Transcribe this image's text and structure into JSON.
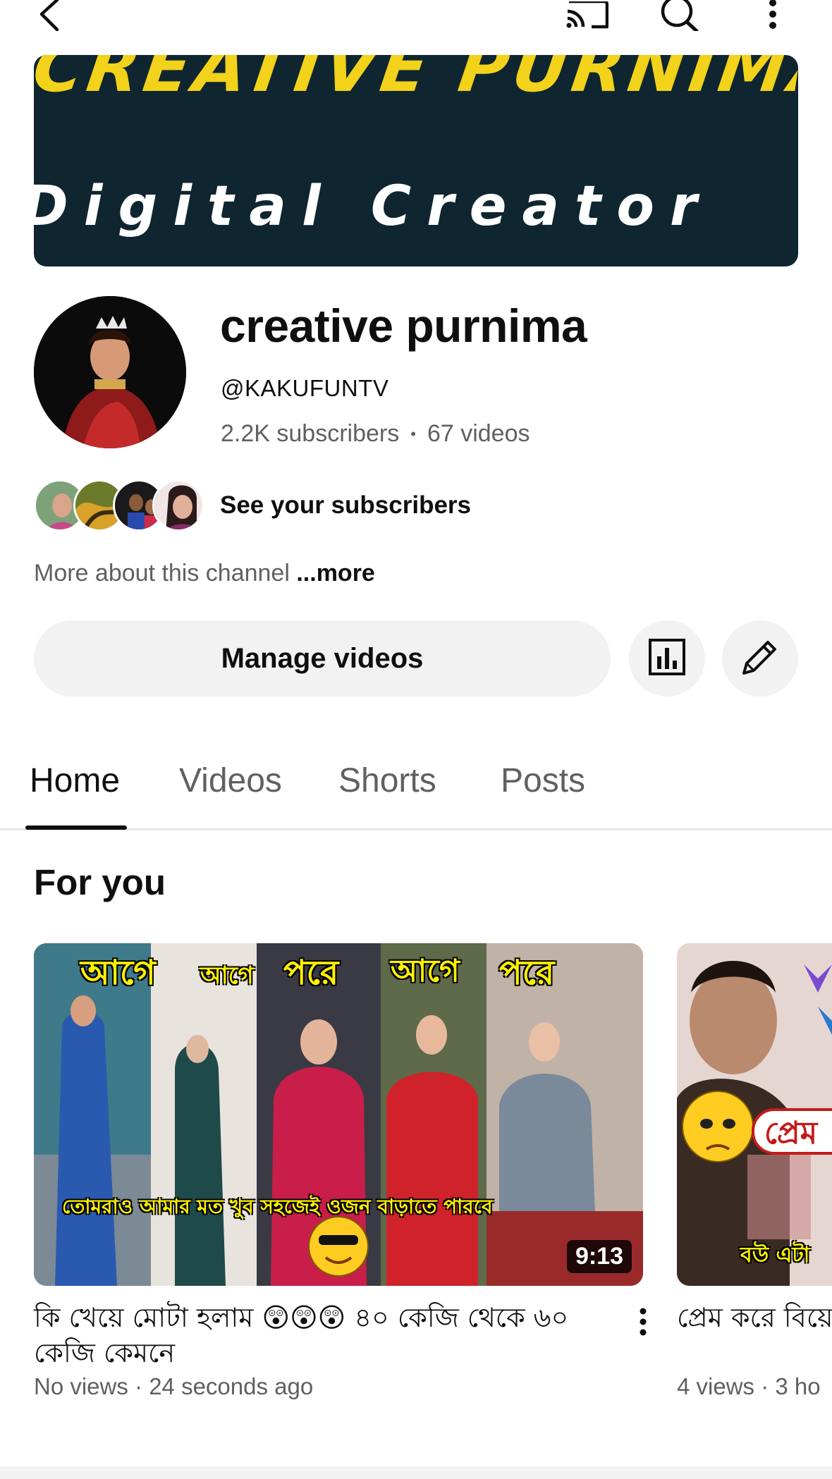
{
  "topbar": {
    "back_icon": "back-arrow-icon",
    "cast_icon": "cast-icon",
    "search_icon": "search-icon",
    "more_icon": "more-vert-icon"
  },
  "banner": {
    "headline": "CREATIVE PURNIMA",
    "subtitle": "Digital Creator"
  },
  "channel": {
    "name": "creative purnima",
    "handle": "@KAKUFUNTV",
    "subscribers": "2.2K subscribers",
    "separator": "•",
    "videos": "67 videos",
    "see_subscribers": "See your subscribers",
    "more_about": "More about this channel",
    "more_link": "...more"
  },
  "actions": {
    "manage_videos": "Manage videos",
    "stats_icon": "analytics-icon",
    "edit_icon": "pencil-icon"
  },
  "tabs": [
    {
      "label": "Home",
      "active": true
    },
    {
      "label": "Videos",
      "active": false
    },
    {
      "label": "Shorts",
      "active": false
    },
    {
      "label": "Posts",
      "active": false
    }
  ],
  "section": {
    "title": "For you"
  },
  "videos": [
    {
      "title": "কি খেয়ে মোটা হলাম 😲😲😲 ৪০ কেজি থেকে ৬০ কেজি কেমনে",
      "meta": "No views · 24 seconds ago",
      "duration": "9:13",
      "thumb_labels": [
        "আগে",
        "আগে",
        "পরে",
        "আগে",
        "পরে"
      ],
      "thumb_caption": "তোমরাও আমার মত খুব সহজেই ওজন বাড়াতে পারবে"
    },
    {
      "title": "প্রেম করে বিয়ে আবদার মেটা",
      "meta": "4 views · 3 ho",
      "thumb_label": "প্রেম",
      "thumb_caption": "বউ এটা"
    }
  ],
  "colors": {
    "accent_text": "#0f0f0f",
    "secondary_text": "#606060",
    "chip_bg": "#f2f2f2",
    "banner_bg": "#0f2630",
    "banner_yellow": "#f2d21a"
  }
}
